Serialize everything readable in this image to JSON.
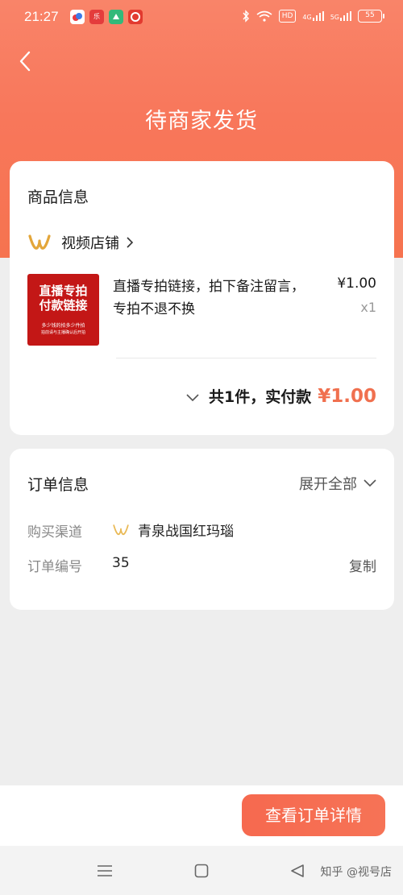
{
  "status_bar": {
    "time": "21:27",
    "apps": [
      {
        "name": "weather-app-icon",
        "text": "",
        "color": "#e9383f"
      },
      {
        "name": "music-app-icon",
        "text": "乐",
        "color": "#e43c3c"
      },
      {
        "name": "game-app-icon",
        "text": "",
        "color": "#33b97a"
      },
      {
        "name": "netease-app-icon",
        "text": "",
        "color": "#e23a2f"
      }
    ],
    "hd_label": "HD",
    "signal1": "4G",
    "signal2": "5G",
    "battery": "55"
  },
  "header": {
    "title": "待商家发货"
  },
  "goods": {
    "section_title": "商品信息",
    "shop_name": "视频店铺",
    "thumb": {
      "line1": "直播专拍",
      "line2": "付款链接",
      "line3": "多少钱的拍多少件拍",
      "line4": "拍前请与主播确认后开拍"
    },
    "product_name": "直播专拍链接，拍下备注留言，专拍不退不换",
    "price": "¥1.00",
    "quantity": "x1",
    "summary_text": "共1件，实付款",
    "summary_amount": "¥1.00"
  },
  "order": {
    "section_title": "订单信息",
    "expand_label": "展开全部",
    "channel_label": "购买渠道",
    "channel_value": "青泉战国红玛瑙",
    "number_label": "订单编号",
    "number_value": "35",
    "copy_label": "复制"
  },
  "footer": {
    "detail_button": "查看订单详情",
    "watermark": "知乎 @视号店"
  },
  "colors": {
    "accent": "#f6734f",
    "price_red": "#f0704f",
    "logo_gold": "#e3a63a"
  }
}
